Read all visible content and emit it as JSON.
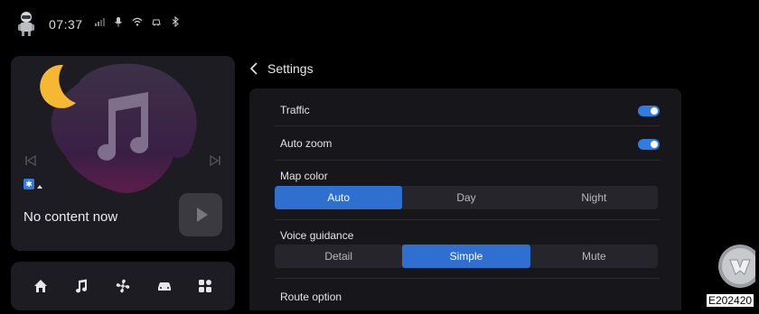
{
  "status_bar": {
    "time": "07:37",
    "icons": [
      "signal-icon",
      "microphone-icon",
      "wifi-icon",
      "connected-car-icon",
      "bluetooth-icon"
    ]
  },
  "media": {
    "status_text": "No content now",
    "icons": [
      "music-note-icon",
      "previous-track-icon",
      "next-track-icon",
      "bluetooth-source-icon",
      "play-icon"
    ]
  },
  "dock": {
    "items": [
      "home-icon",
      "music-icon",
      "fan-icon",
      "car-icon",
      "apps-icon"
    ]
  },
  "settings": {
    "title": "Settings",
    "toggles": [
      {
        "label": "Traffic",
        "on": true
      },
      {
        "label": "Auto zoom",
        "on": true
      }
    ],
    "map_color": {
      "label": "Map color",
      "options": [
        "Auto",
        "Day",
        "Night"
      ],
      "selected": "Auto"
    },
    "voice_guidance": {
      "label": "Voice guidance",
      "options": [
        "Detail",
        "Simple",
        "Mute"
      ],
      "selected": "Simple"
    },
    "route_option": {
      "label": "Route option"
    }
  },
  "figure_code": "E202420",
  "colors": {
    "accent": "#2f7de1",
    "panel": "#1c1c22",
    "card": "#16161b",
    "background": "#000000"
  }
}
